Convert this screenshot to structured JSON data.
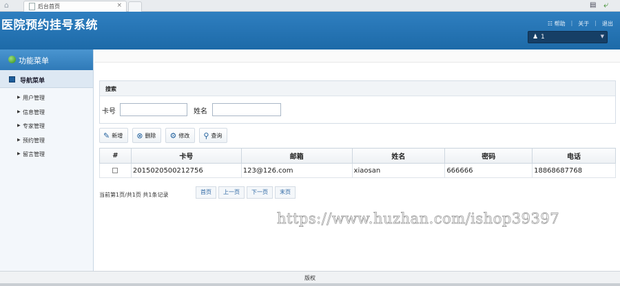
{
  "browser": {
    "tab_title": "后台首页",
    "tab_close": "×"
  },
  "header": {
    "app_title": "医院预约挂号系统",
    "links": {
      "help": "帮助",
      "about": "关于",
      "logout": "退出"
    },
    "user_name": "1"
  },
  "sidebar": {
    "title": "功能菜单",
    "nav_header": "导航菜单",
    "items": [
      {
        "label": "用户管理"
      },
      {
        "label": "信息管理"
      },
      {
        "label": "专家管理"
      },
      {
        "label": "预约管理"
      },
      {
        "label": "留言管理"
      }
    ]
  },
  "search": {
    "panel_title": "搜索",
    "card_label": "卡号",
    "card_value": "",
    "name_label": "姓名",
    "name_value": ""
  },
  "toolbar": {
    "add": "新增",
    "delete": "删除",
    "edit": "修改",
    "query": "查询"
  },
  "table": {
    "columns": [
      "#",
      "卡号",
      "邮箱",
      "姓名",
      "密码",
      "电话"
    ],
    "rows": [
      {
        "card": "2015020500212756",
        "email": "123@126.com",
        "name": "xiaosan",
        "password": "666666",
        "phone": "18868687768"
      }
    ]
  },
  "pager": {
    "info": "当前第1页/共1页  共1条记录",
    "first": "首页",
    "prev": "上一页",
    "next": "下一页",
    "last": "末页"
  },
  "watermark": "https://www.huzhan.com/ishop39397",
  "footer": {
    "text": "版权"
  },
  "colors": {
    "header": "#2376b6",
    "sidebar_head": "#3c88c5",
    "link": "#2c66a3"
  }
}
